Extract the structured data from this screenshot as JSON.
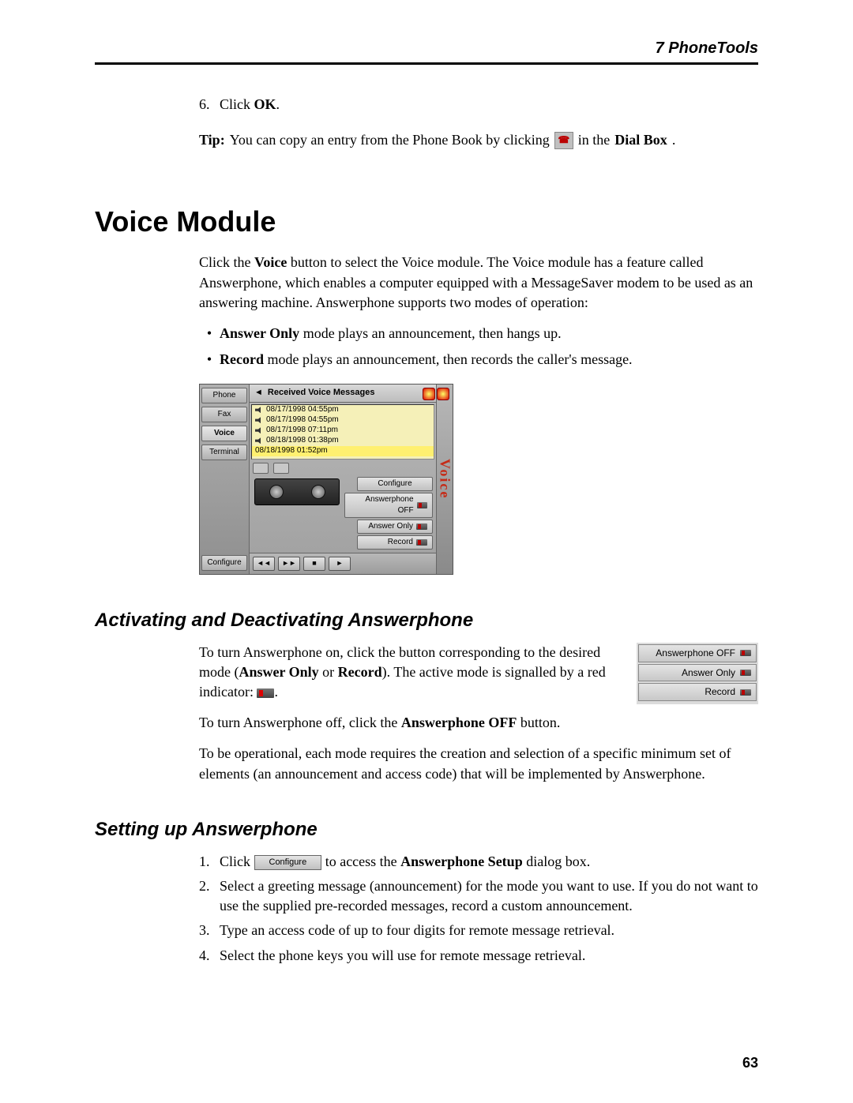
{
  "header": {
    "chapter": "7  PhoneTools"
  },
  "step6": {
    "num": "6.",
    "pre": "Click ",
    "bold": "OK",
    "post": "."
  },
  "tip": {
    "label": "Tip:",
    "a": " You can copy an entry from the Phone Book by clicking ",
    "b": " in the ",
    "bold": "Dial Box",
    "c": "."
  },
  "h1": "Voice Module",
  "intro": {
    "a": "Click the ",
    "b": "Voice",
    "c": " button to select the Voice module. The Voice module has a feature called Answerphone, which enables a computer equipped with a MessageSaver modem to be used as an answering machine. Answerphone supports two modes of operation:"
  },
  "bullets": [
    {
      "b": "Answer Only",
      "t": " mode plays an announcement, then hangs up."
    },
    {
      "b": "Record",
      "t": " mode plays an announcement, then records the caller's message."
    }
  ],
  "shot": {
    "side": {
      "phone": "Phone",
      "fax": "Fax",
      "voice": "Voice",
      "terminal": "Terminal",
      "configure": "Configure"
    },
    "title": "Received Voice Messages",
    "rows": [
      "08/17/1998 04:55pm",
      "08/17/1998 04:55pm",
      "08/17/1998 07:11pm",
      "08/18/1998 01:38pm",
      "08/18/1998 01:52pm"
    ],
    "configure": "Configure",
    "off": "Answerphone OFF",
    "ao": "Answer Only",
    "rec": "Record",
    "edge": "Voice",
    "pb": {
      "rw": "◄◄",
      "ff": "►►",
      "stop": "■",
      "play": "►"
    }
  },
  "h2a": "Activating and Deactivating Answerphone",
  "modestack": {
    "off": "Answerphone OFF",
    "ao": "Answer Only",
    "rec": "Record"
  },
  "act": {
    "p1a": "To turn Answerphone on, click the button corresponding to the desired mode (",
    "p1b": "Answer Only",
    "p1c": " or ",
    "p1d": "Record",
    "p1e": "). The active mode is signalled by a red indicator: ",
    "p1f": ".",
    "p2a": "To turn Answerphone off, click the ",
    "p2b": "Answerphone OFF",
    "p2c": " button.",
    "p3": "To be operational, each mode requires the creation and selection of a specific minimum set of elements (an announcement and access code) that will be implemented by Answerphone."
  },
  "h2b": "Setting up Answerphone",
  "setup": {
    "s1": {
      "n": "1.",
      "a": "Click ",
      "btn": "Configure",
      "b": " to access the ",
      "bold": "Answerphone Setup",
      "c": " dialog box."
    },
    "s2": {
      "n": "2.",
      "t": "Select a greeting message (announcement) for the mode you want to use. If you do not want to use the supplied pre-recorded messages, record a custom announcement."
    },
    "s3": {
      "n": "3.",
      "t": "Type an access code of up to four digits for remote message retrieval."
    },
    "s4": {
      "n": "4.",
      "t": "Select the phone keys you will use for remote message retrieval."
    }
  },
  "pagenum": "63"
}
